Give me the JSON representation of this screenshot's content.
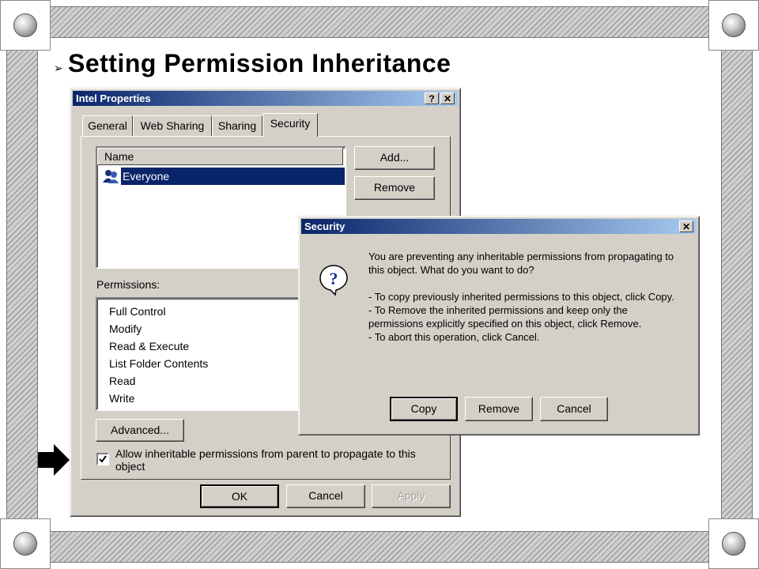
{
  "slide": {
    "bullet": "➢",
    "title": "Setting Permission Inheritance"
  },
  "properties_dialog": {
    "title": "Intel Properties",
    "help_button": "?",
    "close_button": "✕",
    "tabs": [
      "General",
      "Web Sharing",
      "Sharing",
      "Security"
    ],
    "active_tab": "Security",
    "name_column": "Name",
    "users": [
      {
        "name": "Everyone"
      }
    ],
    "add_button": "Add...",
    "remove_button": "Remove",
    "permissions_label": "Permissions:",
    "permissions": [
      "Full Control",
      "Modify",
      "Read & Execute",
      "List Folder Contents",
      "Read",
      "Write"
    ],
    "advanced_button": "Advanced...",
    "inherit_checkbox_label": "Allow inheritable permissions from parent to propagate to this object",
    "inherit_checked": true,
    "ok_button": "OK",
    "cancel_button": "Cancel",
    "apply_button": "Apply"
  },
  "security_dialog": {
    "title": "Security",
    "close_button": "✕",
    "icon": "question-icon",
    "message_line1": "You are preventing any inheritable permissions from propagating to this object.  What do you want to do?",
    "message_line2": "- To copy previously inherited permissions to this object, click Copy.",
    "message_line3": "- To Remove the inherited permissions and keep only the permissions explicitly specified on this object, click Remove.",
    "message_line4": "- To abort this operation, click Cancel.",
    "copy_button": "Copy",
    "remove_button": "Remove",
    "cancel_button": "Cancel"
  }
}
